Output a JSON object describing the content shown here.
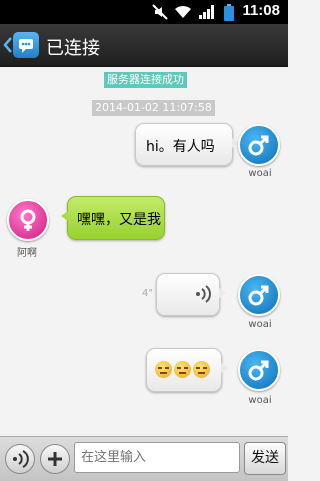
{
  "status_bar": {
    "time": "11:08",
    "icons": [
      "mute-icon",
      "wifi-icon",
      "signal-icon",
      "battery-icon"
    ]
  },
  "app_bar": {
    "title": "已连接",
    "icons": [
      "back-icon",
      "app-logo-icon"
    ]
  },
  "chat": {
    "notice": "服务器连接成功",
    "timestamp": "2014-01-02 11:07:58",
    "messages": [
      {
        "sender": "woai",
        "direction": "out",
        "type": "text",
        "text": "hi。有人吗"
      },
      {
        "sender": "阿啊",
        "direction": "in",
        "type": "text",
        "text": "嘿嘿，又是我"
      },
      {
        "sender": "woai",
        "direction": "out",
        "type": "voice",
        "duration": "4\""
      },
      {
        "sender": "woai",
        "direction": "out",
        "type": "emoji",
        "emoji_count": 3,
        "emoji": "unamused-face-icon"
      }
    ]
  },
  "composer": {
    "placeholder": "在这里输入",
    "send_label": "发送",
    "icons": [
      "voice-toggle-icon",
      "plus-icon"
    ]
  },
  "colors": {
    "notice_bg": "#5fc8b8",
    "in_bubble": "#a9db45",
    "male_avatar": "#1a86d0",
    "female_avatar": "#e0328f"
  }
}
